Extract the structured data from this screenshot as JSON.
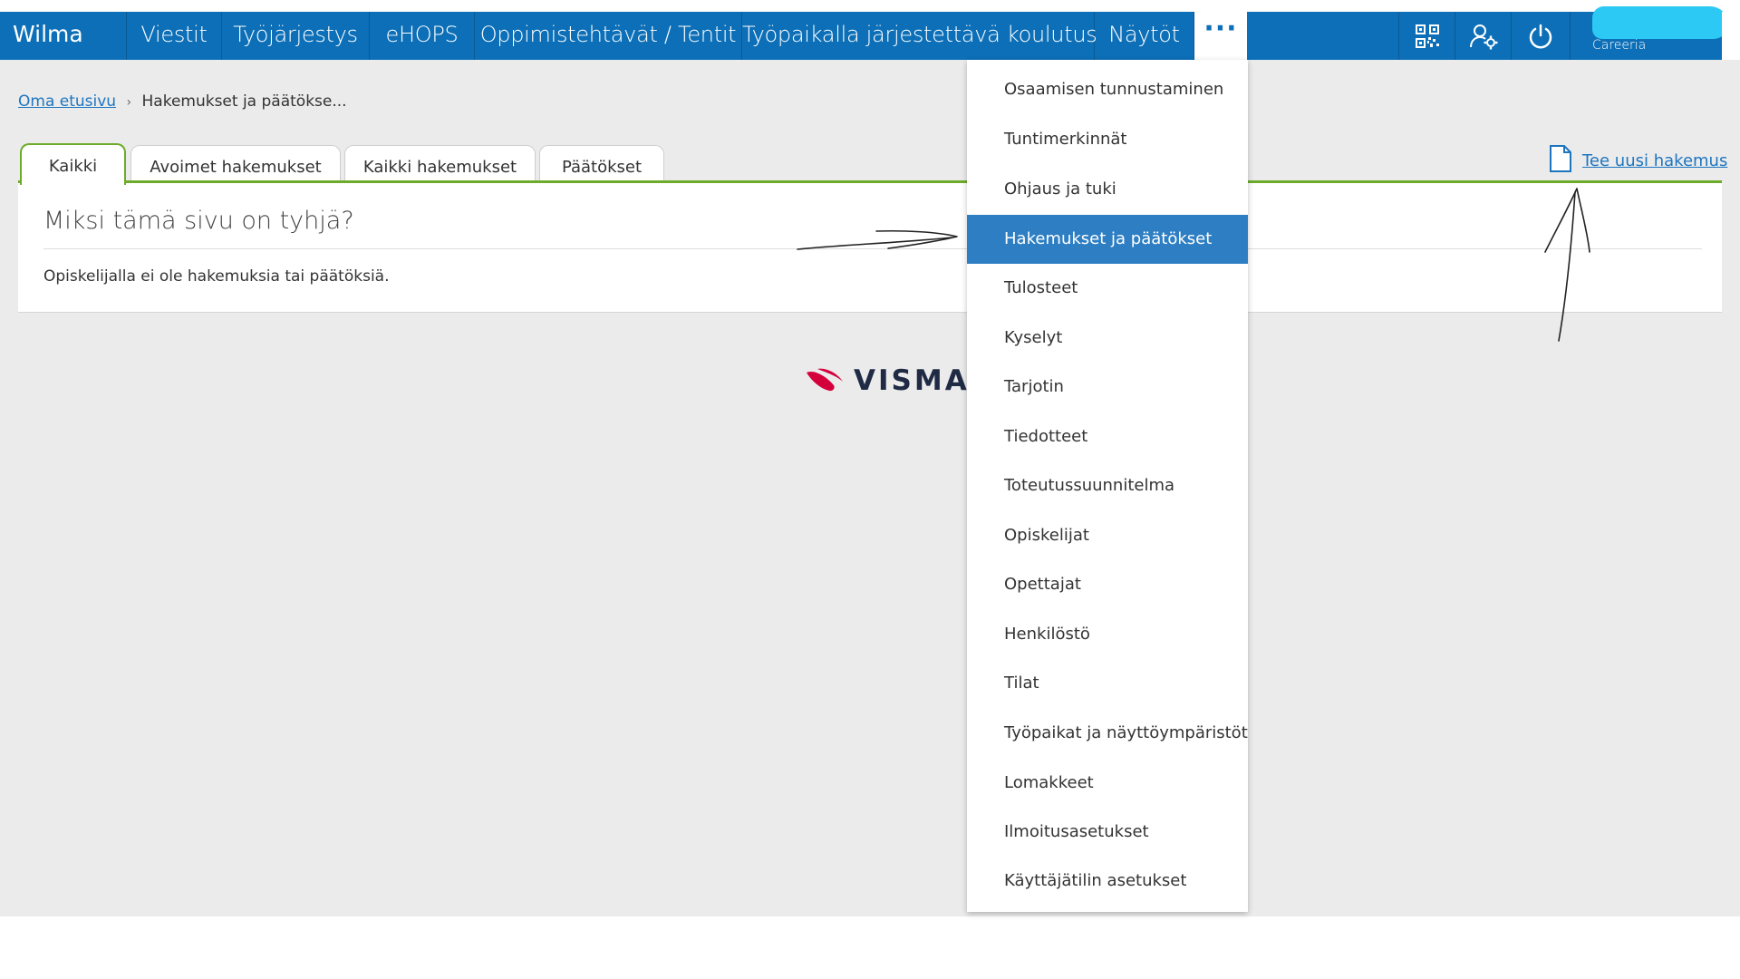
{
  "nav": {
    "brand": "Wilma",
    "items": [
      "Viestit",
      "Työjärjestys",
      "eHOPS",
      "Oppimistehtävät / Tentit",
      "Työpaikalla järjestettävä koulutus",
      "Näytöt"
    ],
    "more_label": "···",
    "icons": [
      "qr-code-icon",
      "user-settings-icon",
      "power-icon"
    ],
    "user_school": "Careeria"
  },
  "breadcrumb": {
    "home": "Oma etusivu",
    "separator": "›",
    "current": "Hakemukset ja päätökse..."
  },
  "tabs": [
    "Kaikki",
    "Avoimet hakemukset",
    "Kaikki hakemukset",
    "Päätökset"
  ],
  "active_tab": "Kaikki",
  "new_application": {
    "icon": "document-icon",
    "label": "Tee uusi hakemus"
  },
  "panel": {
    "title": "Miksi tämä sivu on tyhjä?",
    "text": "Opiskelijalla ei ole hakemuksia tai päätöksiä."
  },
  "footer_logo": "VISMA",
  "dropdown": {
    "items": [
      "Osaamisen tunnustaminen",
      "Tuntimerkinnät",
      "Ohjaus ja tuki",
      "Hakemukset ja päätökset",
      "Tulosteet",
      "Kyselyt",
      "Tarjotin",
      "Tiedotteet",
      "Toteutussuunnitelma",
      "Opiskelijat",
      "Opettajat",
      "Henkilöstö",
      "Tilat",
      "Työpaikat ja näyttöympäristöt",
      "Lomakkeet",
      "Ilmoitusasetukset",
      "Käyttäjätilin asetukset"
    ],
    "selected": "Hakemukset ja päätökset"
  },
  "colors": {
    "nav": "#0c6fb7",
    "accent_green": "#6cac2a",
    "link": "#1d75c0",
    "selected": "#2d7ec3",
    "visma_red": "#d4003c"
  }
}
